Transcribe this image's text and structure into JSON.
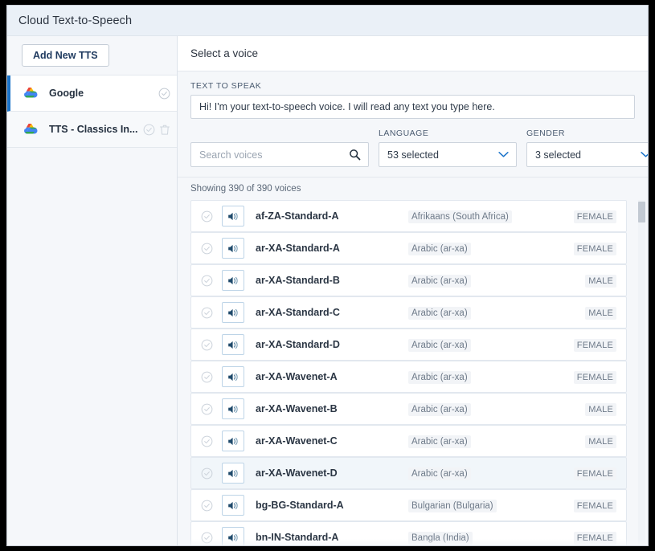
{
  "window": {
    "title": "Cloud Text-to-Speech"
  },
  "sidebar": {
    "add_button_label": "Add New TTS",
    "items": [
      {
        "label": "Google",
        "icon": "google-cloud-icon",
        "active": true,
        "has_delete": false
      },
      {
        "label": "TTS - Classics In...",
        "icon": "google-cloud-icon",
        "active": false,
        "has_delete": true
      }
    ]
  },
  "main": {
    "header_title": "Select a voice",
    "text_to_speak": {
      "label": "TEXT TO SPEAK",
      "value": "Hi! I'm your text-to-speech voice. I will read any text you type here."
    },
    "search": {
      "placeholder": "Search voices",
      "value": "",
      "icon": "search-icon"
    },
    "language_filter": {
      "label": "LANGUAGE",
      "value": "53 selected",
      "icon": "chevron-down-icon"
    },
    "gender_filter": {
      "label": "GENDER",
      "value": "3 selected",
      "icon": "chevron-down-icon"
    },
    "showing_text": "Showing 390 of 390 voices",
    "voice_columns": [
      "select",
      "preview",
      "name",
      "language",
      "gender"
    ],
    "voices": [
      {
        "name": "af-ZA-Standard-A",
        "language": "Afrikaans (South Africa)",
        "gender": "FEMALE",
        "selected": false
      },
      {
        "name": "ar-XA-Standard-A",
        "language": "Arabic (ar-xa)",
        "gender": "FEMALE",
        "selected": false
      },
      {
        "name": "ar-XA-Standard-B",
        "language": "Arabic (ar-xa)",
        "gender": "MALE",
        "selected": false
      },
      {
        "name": "ar-XA-Standard-C",
        "language": "Arabic (ar-xa)",
        "gender": "MALE",
        "selected": false
      },
      {
        "name": "ar-XA-Standard-D",
        "language": "Arabic (ar-xa)",
        "gender": "FEMALE",
        "selected": false
      },
      {
        "name": "ar-XA-Wavenet-A",
        "language": "Arabic (ar-xa)",
        "gender": "FEMALE",
        "selected": false
      },
      {
        "name": "ar-XA-Wavenet-B",
        "language": "Arabic (ar-xa)",
        "gender": "MALE",
        "selected": false
      },
      {
        "name": "ar-XA-Wavenet-C",
        "language": "Arabic (ar-xa)",
        "gender": "MALE",
        "selected": false
      },
      {
        "name": "ar-XA-Wavenet-D",
        "language": "Arabic (ar-xa)",
        "gender": "FEMALE",
        "selected": true
      },
      {
        "name": "bg-BG-Standard-A",
        "language": "Bulgarian (Bulgaria)",
        "gender": "FEMALE",
        "selected": false
      },
      {
        "name": "bn-IN-Standard-A",
        "language": "Bangla (India)",
        "gender": "FEMALE",
        "selected": false
      }
    ]
  },
  "colors": {
    "accent": "#1a73c9",
    "titlebar_bg": "#eaf0f7",
    "panel_bg": "#f5f7fa",
    "speaker_icon": "#1f4a6b",
    "text_primary": "#2b3644",
    "text_muted": "#6e7a89"
  }
}
